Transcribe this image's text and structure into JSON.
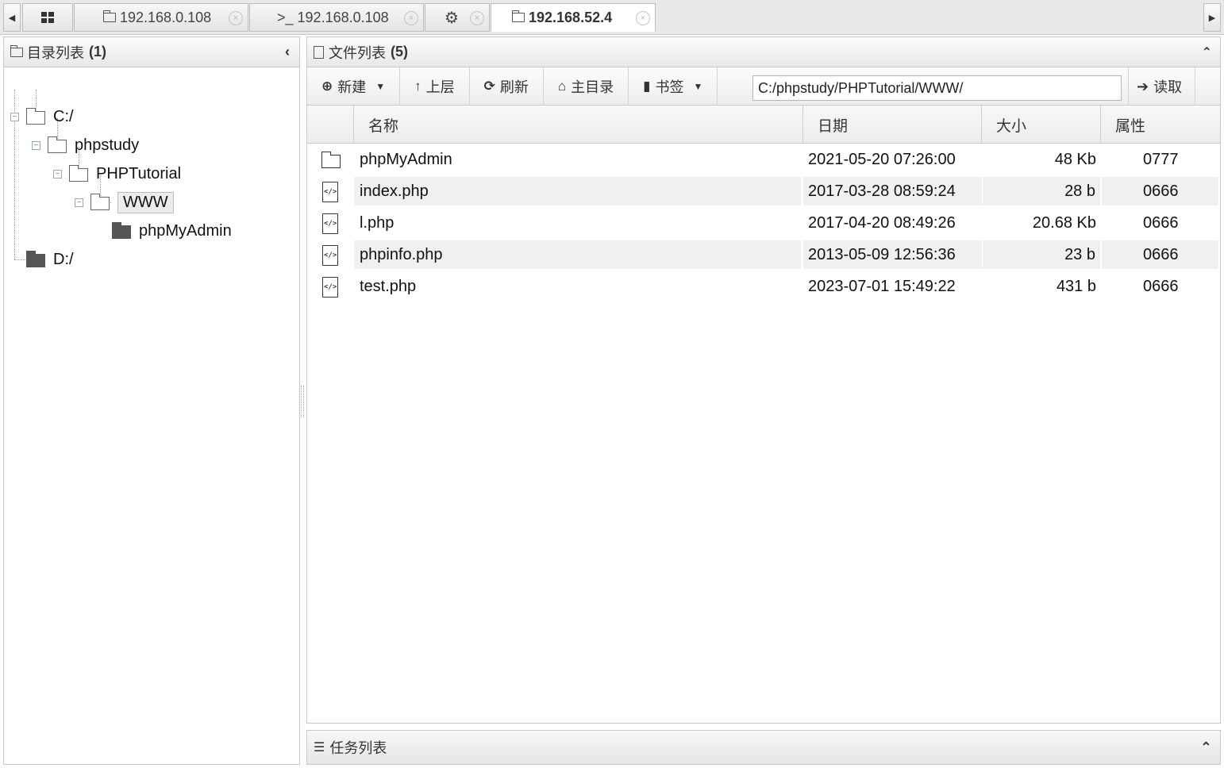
{
  "tabs": [
    {
      "icon": "grid-icon",
      "label": ""
    },
    {
      "icon": "folder-icon",
      "label": "192.168.0.108"
    },
    {
      "icon": "terminal-icon",
      "icon_text": ">_",
      "label": "192.168.0.108"
    },
    {
      "icon": "gear-icon",
      "label": ""
    },
    {
      "icon": "folder-icon",
      "label": "192.168.52.4",
      "active": true
    }
  ],
  "tab_close_glyph": "×",
  "tab_scroll": {
    "left": "◀",
    "right": "▶"
  },
  "dir_panel": {
    "title": "目录列表",
    "count": "(1)",
    "collapse_glyph": "‹",
    "tree": [
      {
        "label": "C:/",
        "level": 0
      },
      {
        "label": "phpstudy",
        "level": 1
      },
      {
        "label": "PHPTutorial",
        "level": 2
      },
      {
        "label": "WWW",
        "level": 3,
        "selected": true
      },
      {
        "label": "phpMyAdmin",
        "level": 4
      },
      {
        "label": "D:/",
        "level": 0
      }
    ],
    "toggle_glyph": "−"
  },
  "file_panel": {
    "title": "文件列表",
    "count": "(5)",
    "collapse_glyph": "⌃"
  },
  "toolbar": {
    "new_label": "新建",
    "up_label": "上层",
    "refresh_label": "刷新",
    "home_label": "主目录",
    "bookmark_label": "书签",
    "path_value": "C:/phpstudy/PHPTutorial/WWW/",
    "read_label": "读取",
    "icons": {
      "new": "⊕",
      "up": "↑",
      "refresh": "⟳",
      "home": "⌂",
      "bookmark": "▮",
      "read": "➔",
      "caret": "▼"
    }
  },
  "columns": {
    "name": "名称",
    "date": "日期",
    "size": "大小",
    "attr": "属性"
  },
  "files": [
    {
      "type": "folder",
      "name": "phpMyAdmin",
      "date": "2021-05-20 07:26:00",
      "size": "48 Kb",
      "attr": "0777"
    },
    {
      "type": "php",
      "name": "index.php",
      "date": "2017-03-28 08:59:24",
      "size": "28 b",
      "attr": "0666"
    },
    {
      "type": "php",
      "name": "l.php",
      "date": "2017-04-20 08:49:26",
      "size": "20.68 Kb",
      "attr": "0666"
    },
    {
      "type": "php",
      "name": "phpinfo.php",
      "date": "2013-05-09 12:56:36",
      "size": "23 b",
      "attr": "0666"
    },
    {
      "type": "php",
      "name": "test.php",
      "date": "2023-07-01 15:49:22",
      "size": "431 b",
      "attr": "0666"
    }
  ],
  "task_panel": {
    "title": "任务列表",
    "icon_glyph": "☰",
    "collapse_glyph": "⌃"
  }
}
